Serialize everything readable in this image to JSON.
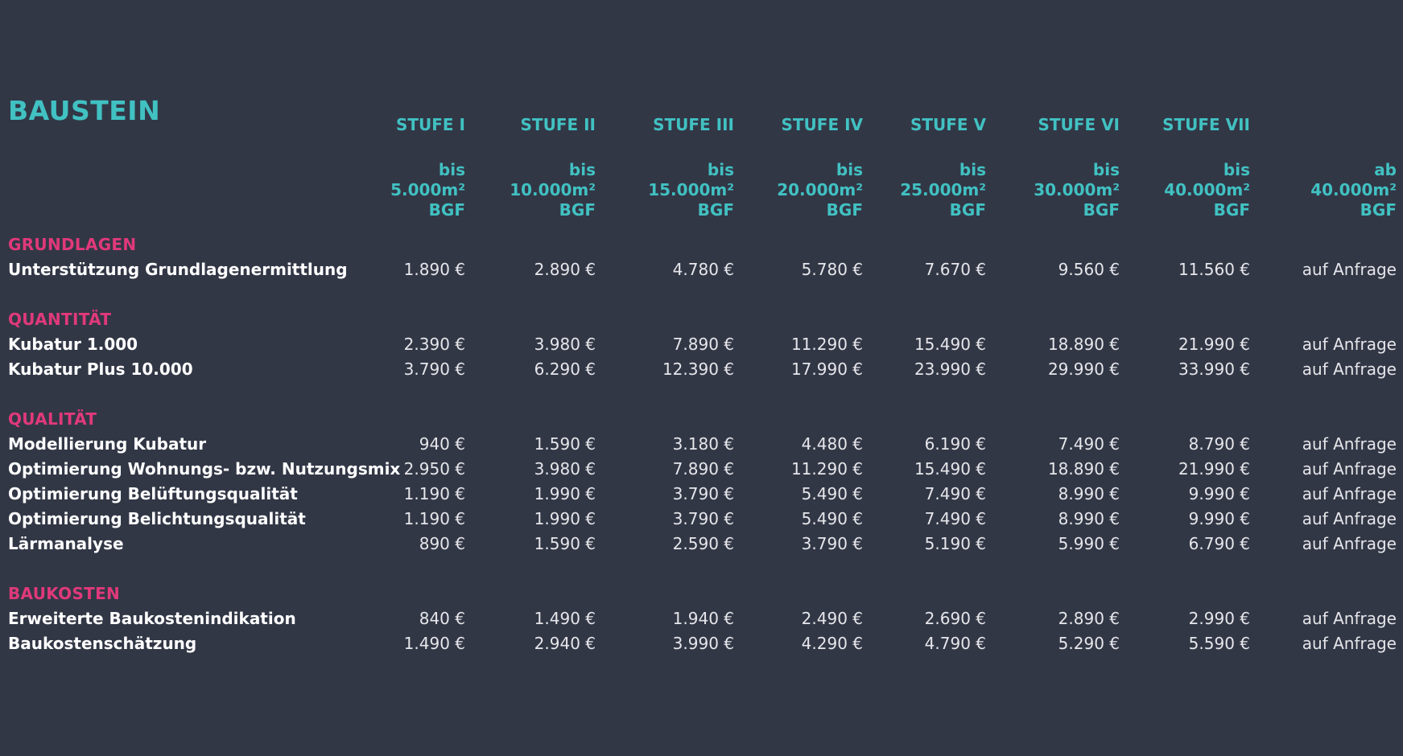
{
  "title": "BAUSTEIN",
  "columns": [
    {
      "label": "STUFE I",
      "range": [
        "bis",
        "5.000m²",
        "BGF"
      ]
    },
    {
      "label": "STUFE II",
      "range": [
        "bis",
        "10.000m²",
        "BGF"
      ]
    },
    {
      "label": "STUFE III",
      "range": [
        "bis",
        "15.000m²",
        "BGF"
      ]
    },
    {
      "label": "STUFE IV",
      "range": [
        "bis",
        "20.000m²",
        "BGF"
      ]
    },
    {
      "label": "STUFE V",
      "range": [
        "bis",
        "25.000m²",
        "BGF"
      ]
    },
    {
      "label": "STUFE VI",
      "range": [
        "bis",
        "30.000m²",
        "BGF"
      ]
    },
    {
      "label": "STUFE VII",
      "range": [
        "bis",
        "40.000m²",
        "BGF"
      ]
    },
    {
      "label": "",
      "range": [
        "ab",
        "40.000m²",
        "BGF"
      ]
    }
  ],
  "sections": [
    {
      "name": "GRUNDLAGEN",
      "rows": [
        {
          "label": "Unterstützung Grundlagenermittlung",
          "values": [
            "1.890 €",
            "2.890 €",
            "4.780 €",
            "5.780 €",
            "7.670 €",
            "9.560 €",
            "11.560 €",
            "auf Anfrage"
          ]
        }
      ]
    },
    {
      "name": "QUANTITÄT",
      "rows": [
        {
          "label": "Kubatur 1.000",
          "values": [
            "2.390 €",
            "3.980 €",
            "7.890 €",
            "11.290 €",
            "15.490 €",
            "18.890 €",
            "21.990 €",
            "auf Anfrage"
          ]
        },
        {
          "label": "Kubatur Plus 10.000",
          "values": [
            "3.790 €",
            "6.290 €",
            "12.390 €",
            "17.990 €",
            "23.990 €",
            "29.990 €",
            "33.990 €",
            "auf Anfrage"
          ]
        }
      ]
    },
    {
      "name": "QUALITÄT",
      "rows": [
        {
          "label": "Modellierung Kubatur",
          "values": [
            "940 €",
            "1.590 €",
            "3.180 €",
            "4.480 €",
            "6.190 €",
            "7.490 €",
            "8.790 €",
            "auf Anfrage"
          ]
        },
        {
          "label": "Optimierung Wohnungs- bzw. Nutzungsmix",
          "values": [
            "2.950 €",
            "3.980 €",
            "7.890 €",
            "11.290 €",
            "15.490 €",
            "18.890 €",
            "21.990 €",
            "auf Anfrage"
          ]
        },
        {
          "label": "Optimierung Belüftungsqualität",
          "values": [
            "1.190 €",
            "1.990 €",
            "3.790 €",
            "5.490 €",
            "7.490 €",
            "8.990 €",
            "9.990 €",
            "auf Anfrage"
          ]
        },
        {
          "label": "Optimierung Belichtungsqualität",
          "values": [
            "1.190 €",
            "1.990 €",
            "3.790 €",
            "5.490 €",
            "7.490 €",
            "8.990 €",
            "9.990 €",
            "auf Anfrage"
          ]
        },
        {
          "label": "Lärmanalyse",
          "values": [
            "890 €",
            "1.590 €",
            "2.590 €",
            "3.790 €",
            "5.190 €",
            "5.990 €",
            "6.790 €",
            "auf Anfrage"
          ]
        }
      ]
    },
    {
      "name": "BAUKOSTEN",
      "rows": [
        {
          "label": "Erweiterte Baukostenindikation",
          "values": [
            "840 €",
            "1.490 €",
            "1.940 €",
            "2.490 €",
            "2.690 €",
            "2.890 €",
            "2.990 €",
            "auf Anfrage"
          ]
        },
        {
          "label": "Baukostenschätzung",
          "values": [
            "1.490 €",
            "2.940 €",
            "3.990 €",
            "4.290 €",
            "4.790 €",
            "5.290 €",
            "5.590 €",
            "auf Anfrage"
          ]
        }
      ]
    }
  ]
}
